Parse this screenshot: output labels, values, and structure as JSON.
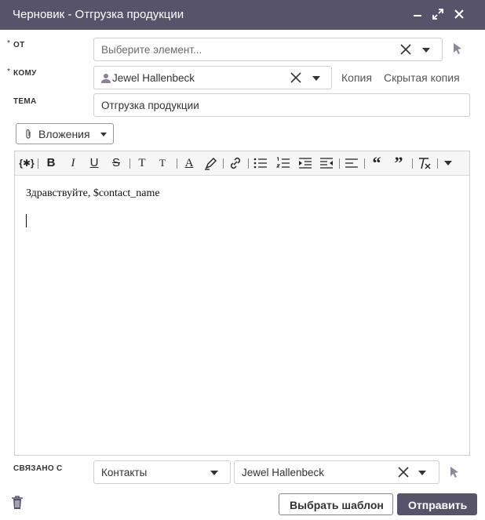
{
  "window": {
    "title": "Черновик - Отгрузка продукции"
  },
  "from": {
    "label": "ОТ",
    "required_mark": "*",
    "placeholder": "Выберите элемент..."
  },
  "to": {
    "label": "КОМУ",
    "required_mark": "*",
    "recipient": "Jewel Hallenbeck",
    "cc_label": "Копия",
    "bcc_label": "Скрытая копия"
  },
  "subject": {
    "label": "ТЕМА",
    "value": "Отгрузка продукции"
  },
  "attachments": {
    "label": "Вложения"
  },
  "toolbar": {
    "items": [
      "{✱}",
      "B",
      "I",
      "U",
      "S",
      "T",
      "T",
      "A",
      "highlight",
      "link",
      "bullet-list",
      "numbered-list",
      "indent",
      "outdent",
      "align",
      "“",
      "”",
      "clear-format",
      "more"
    ]
  },
  "editor": {
    "body_line1": "Здравствуйте, $contact_name"
  },
  "related": {
    "label": "СВЯЗАНО С",
    "type_value": "Контакты",
    "record_value": "Jewel Hallenbeck"
  },
  "footer": {
    "template_button": "Выбрать шаблон",
    "send_button": "Отправить"
  },
  "colors": {
    "titlebar": "#57536b",
    "send_button": "#57536b",
    "border": "#cfcfcf"
  }
}
